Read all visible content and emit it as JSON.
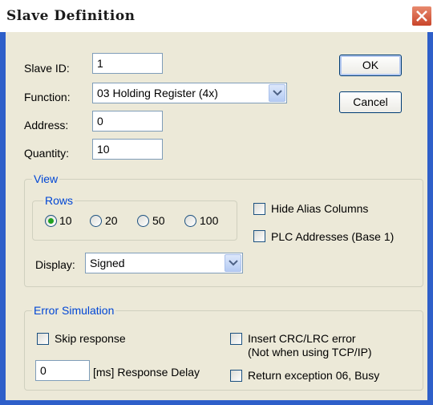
{
  "window": {
    "title": "Slave Definition"
  },
  "form": {
    "slave_id_label": "Slave ID:",
    "slave_id_value": "1",
    "function_label": "Function:",
    "function_value": "03 Holding Register (4x)",
    "address_label": "Address:",
    "address_value": "0",
    "quantity_label": "Quantity:",
    "quantity_value": "10"
  },
  "buttons": {
    "ok": "OK",
    "cancel": "Cancel"
  },
  "view": {
    "legend": "View",
    "rows": {
      "legend": "Rows",
      "options": [
        "10",
        "20",
        "50",
        "100"
      ],
      "selected": "10"
    },
    "hide_alias": "Hide Alias Columns",
    "plc_addresses": "PLC Addresses (Base 1)",
    "display_label": "Display:",
    "display_value": "Signed"
  },
  "error_sim": {
    "legend": "Error Simulation",
    "skip_response": "Skip response",
    "delay_value": "0",
    "delay_label": "[ms] Response Delay",
    "crc_error_line1": "Insert CRC/LRC error",
    "crc_error_line2": "(Not when using TCP/IP)",
    "busy_exception": "Return exception 06, Busy"
  }
}
